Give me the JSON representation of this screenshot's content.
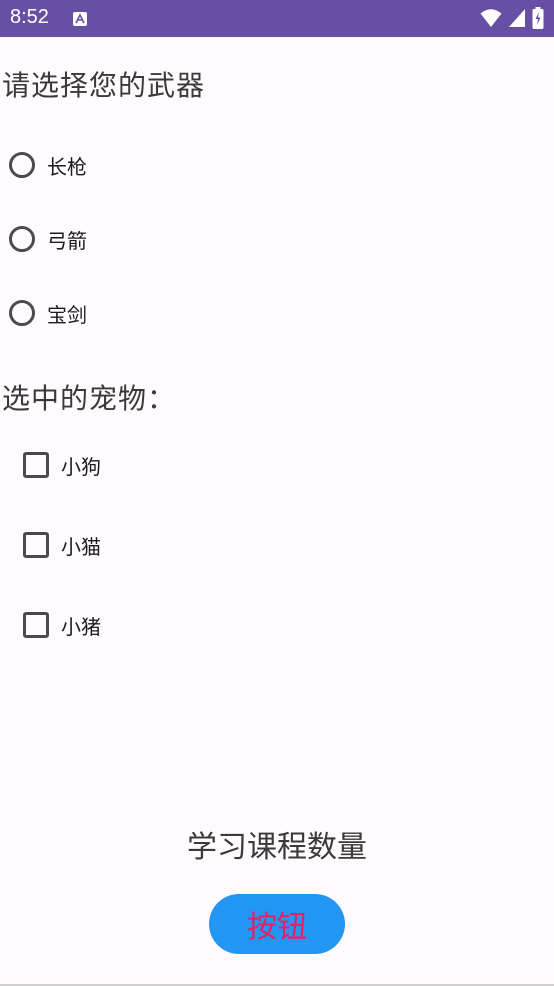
{
  "status_bar": {
    "time": "8:52",
    "bg_color": "#6750a4",
    "icons": [
      "app-notification-icon",
      "wifi-icon",
      "signal-icon",
      "battery-icon"
    ]
  },
  "weapon_section": {
    "title": "请选择您的武器",
    "options": [
      {
        "label": "长枪",
        "checked": false
      },
      {
        "label": "弓箭",
        "checked": false
      },
      {
        "label": "宝剑",
        "checked": false
      }
    ]
  },
  "pet_section": {
    "title": "选中的宠物：",
    "options": [
      {
        "label": "小狗",
        "checked": false
      },
      {
        "label": "小猫",
        "checked": false
      },
      {
        "label": "小猪",
        "checked": false
      }
    ]
  },
  "course_count_label": "学习课程数量",
  "button": {
    "label": "按钮",
    "bg_color": "#2196f3",
    "text_color": "#e91e63"
  }
}
